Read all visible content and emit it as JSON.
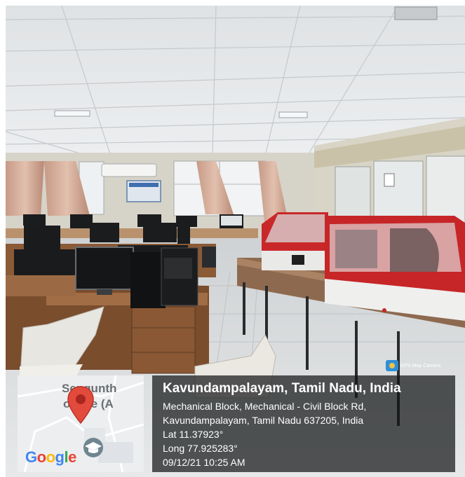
{
  "stamp": {
    "app_badge": "GPS Map Camera",
    "map_label_line1": "Sengunth",
    "map_label_line2": "ollege (A",
    "map_brand": "Google",
    "place_title": "Kavundampalayam, Tamil Nadu, India",
    "address_line1": "Mechanical Block, Mechanical - Civil Block Rd,",
    "address_line2": "Kavundampalayam, Tamil Nadu 637205, India",
    "latitude": "Lat 11.37923°",
    "longitude": "Long 77.925283°",
    "datetime": "09/12/21 10:25 AM"
  },
  "colors": {
    "ceiling": "#e8eaec",
    "wall": "#d9d6cc",
    "machine_red": "#c9282a",
    "panel_bg": "#141618",
    "pin_red": "#e24a3b"
  },
  "icons": [
    "camera-icon",
    "map-pin-icon",
    "graduation-cap-icon"
  ]
}
